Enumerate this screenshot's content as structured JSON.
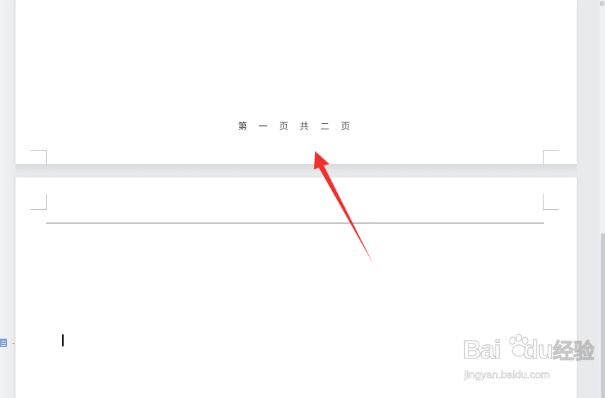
{
  "document": {
    "footer_text": "第 一 页 共 二 页"
  },
  "watermark": {
    "brand": "Bai",
    "brand_suffix": "du",
    "product": "经验",
    "url": "jingyan.baidu.com"
  },
  "colors": {
    "annotation_arrow": "#f0302a",
    "page_background": "#ffffff",
    "workspace_background": "#e9eaec"
  },
  "icons": {
    "side_icon": "document-layout-icon",
    "annotation": "red-arrow-annotation"
  }
}
